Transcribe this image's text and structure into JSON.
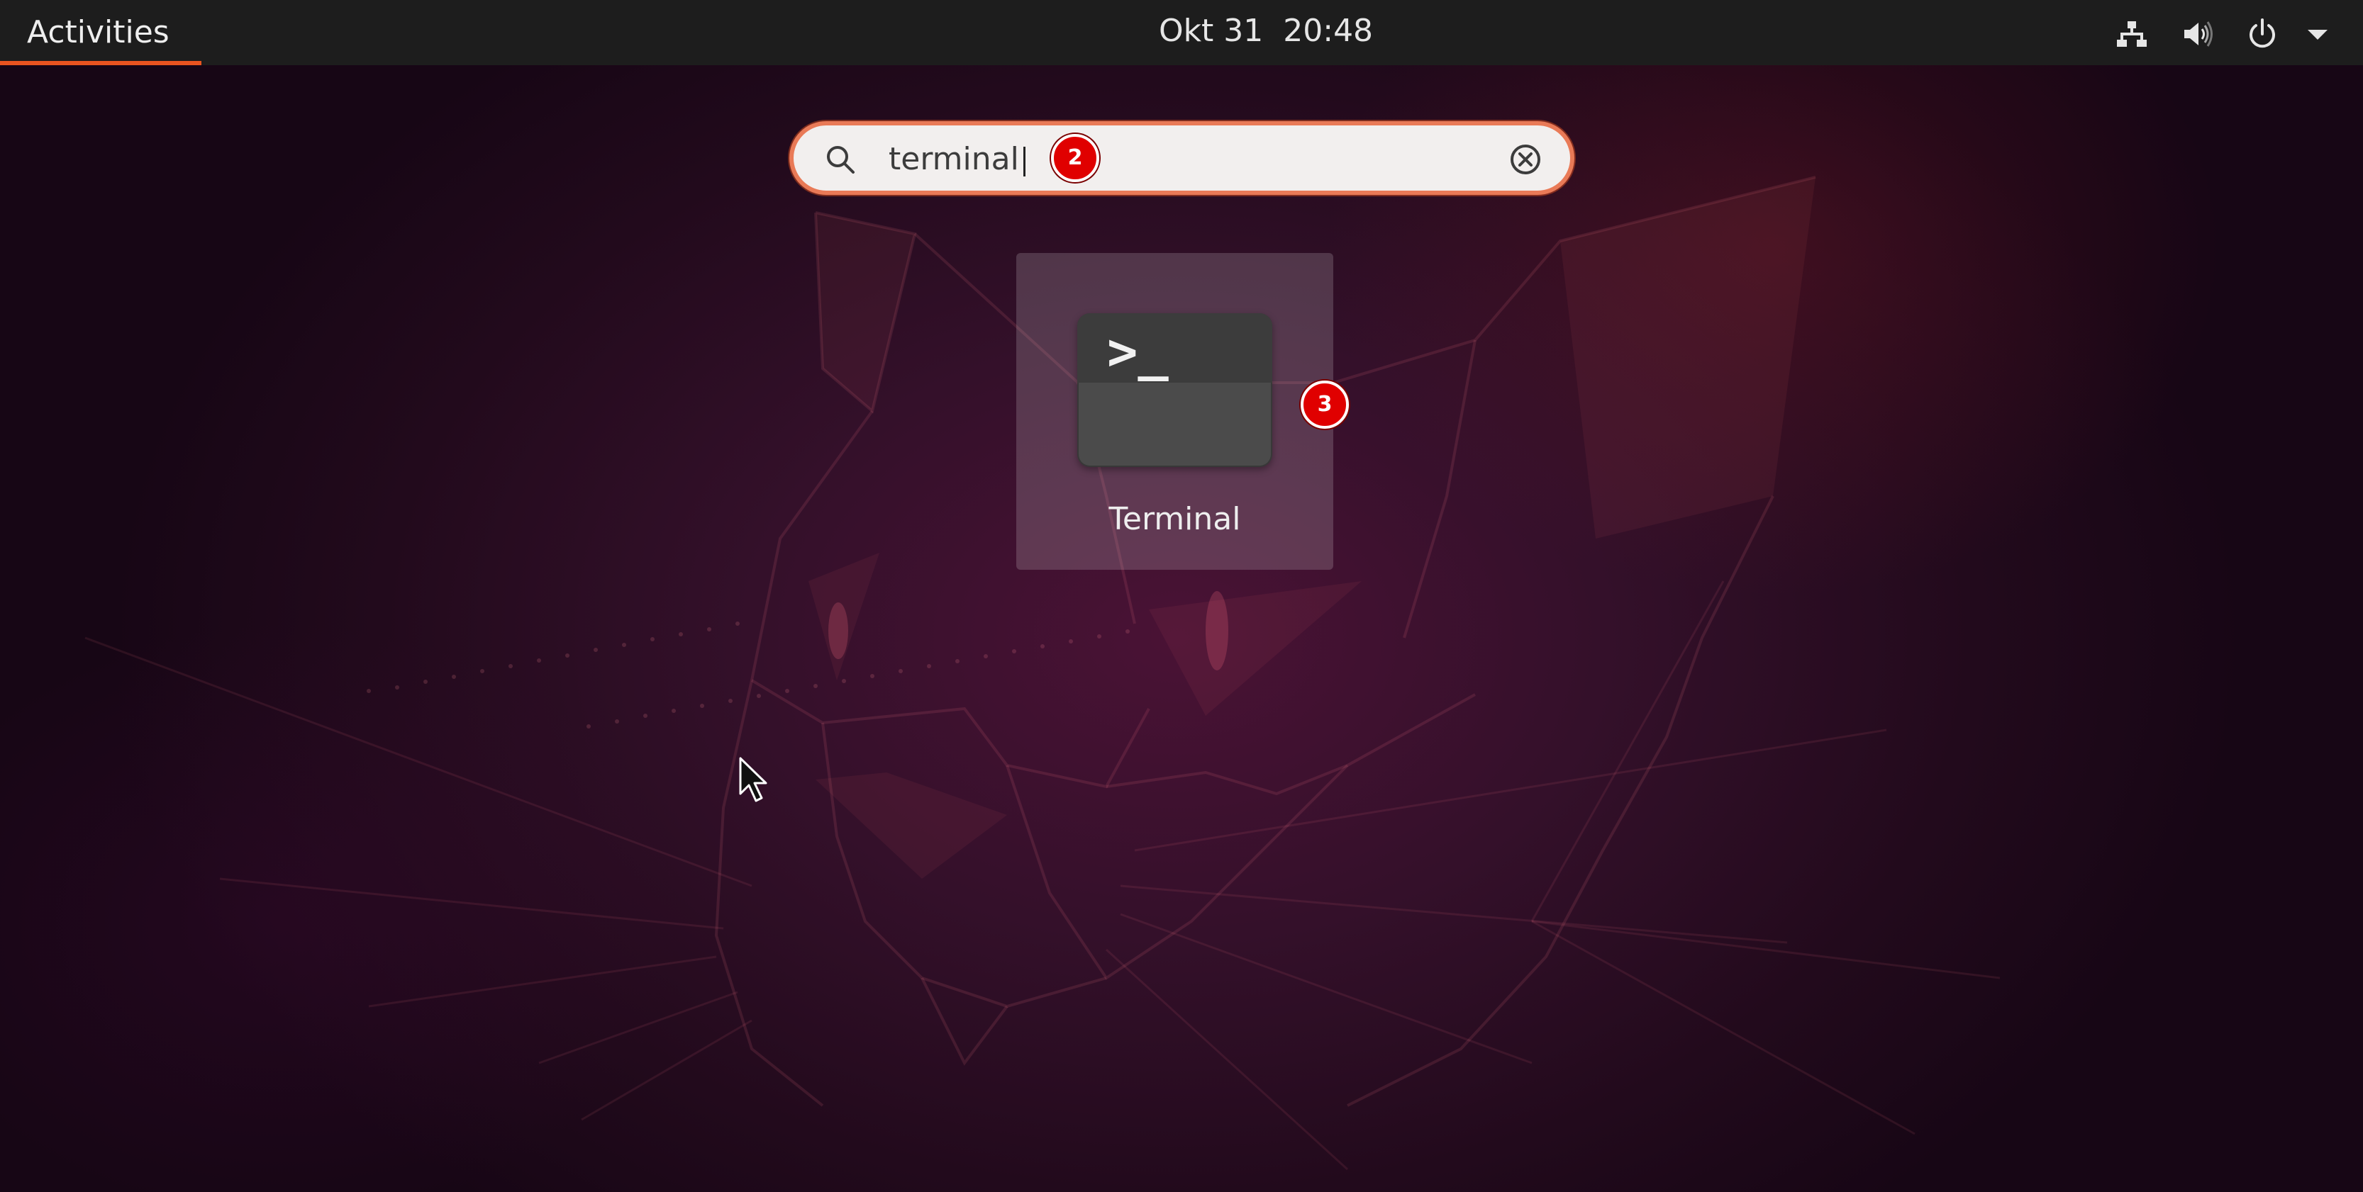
{
  "topbar": {
    "activities_label": "Activities",
    "clock": "Okt 31  20:48",
    "tray": [
      "network-icon",
      "volume-icon",
      "power-icon",
      "chevron-down-icon"
    ]
  },
  "search": {
    "value": "terminal",
    "icon": "search-icon",
    "clear_icon": "clear-icon"
  },
  "results": [
    {
      "label": "Terminal",
      "icon_prompt": ">_"
    }
  ],
  "badges": {
    "search_step": "2",
    "result_step": "3"
  },
  "colors": {
    "accent": "#e95420",
    "badge": "#e00000",
    "topbar": "#1d1d1d"
  }
}
